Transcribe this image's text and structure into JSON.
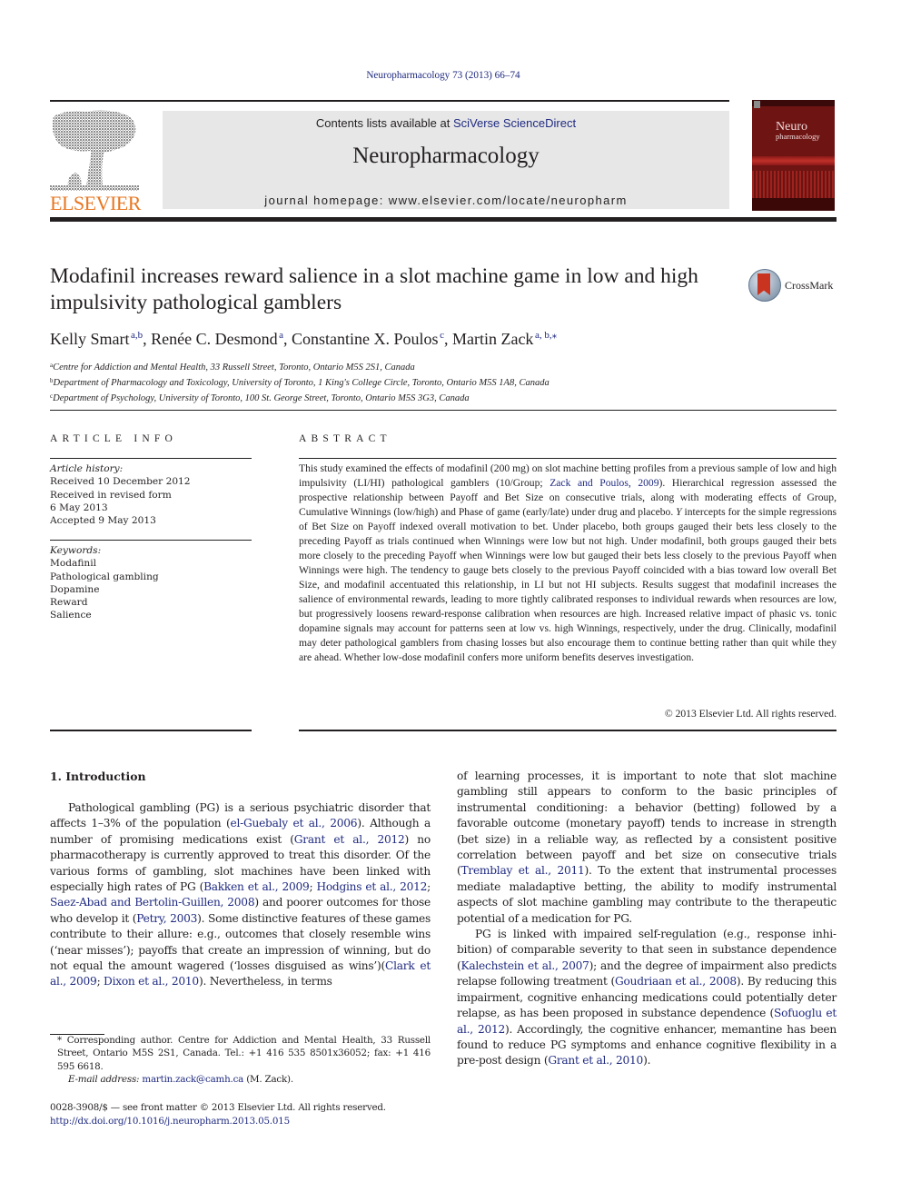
{
  "header": {
    "journal_ref": "Neuropharmacology 73 (2013) 66–74",
    "contents_prefix": "Contents lists available at ",
    "contents_link": "SciVerse ScienceDirect",
    "journal_title": "Neuropharmacology",
    "homepage": "journal homepage: www.elsevier.com/locate/neuropharm",
    "publisher_logo_text": "ELSEVIER",
    "cover": {
      "title_line1": "Neuro",
      "title_line2": "pharmacology"
    },
    "brand_color": "#e87722",
    "link_color": "#1f2a80"
  },
  "article": {
    "title": "Modafinil increases reward salience in a slot machine game in low and high impulsivity pathological gamblers",
    "crossmark_label": "CrossMark",
    "authors": [
      {
        "name": "Kelly Smart",
        "sup": "a,b"
      },
      {
        "name": "Renée C. Desmond",
        "sup": "a"
      },
      {
        "name": "Constantine X. Poulos",
        "sup": "c"
      },
      {
        "name": "Martin Zack",
        "sup": "a, b,⁎"
      }
    ],
    "affiliations": [
      {
        "mark": "a",
        "text": "Centre for Addiction and Mental Health, 33 Russell Street, Toronto, Ontario M5S 2S1, Canada"
      },
      {
        "mark": "b",
        "text": "Department of Pharmacology and Toxicology, University of Toronto, 1 King's College Circle, Toronto, Ontario M5S 1A8, Canada"
      },
      {
        "mark": "c",
        "text": "Department of Psychology, University of Toronto, 100 St. George Street, Toronto, Ontario M5S 3G3, Canada"
      }
    ]
  },
  "article_info": {
    "heading": "ARTICLE INFO",
    "history_label": "Article history:",
    "history": [
      "Received 10 December 2012",
      "Received in revised form",
      "6 May 2013",
      "Accepted 9 May 2013"
    ],
    "keywords_label": "Keywords:",
    "keywords": [
      "Modafinil",
      "Pathological gambling",
      "Dopamine",
      "Reward",
      "Salience"
    ]
  },
  "abstract": {
    "heading": "ABSTRACT",
    "part1": "This study examined the effects of modafinil (200 mg) on slot machine betting profiles from a previous sample of low and high impulsivity (LI/HI) pathological gamblers (10/Group; ",
    "cite1": "Zack and Poulos, 2009",
    "part2": "). Hierarchical regression assessed the prospective relationship between Payoff and Bet Size on consecutive trials, along with moderating effects of Group, Cumulative Winnings (low/high) and Phase of game (early/late) under drug and placebo. ",
    "y_italic": "Y",
    "part3": " intercepts for the simple regressions of Bet Size on Payoff indexed overall motivation to bet. Under placebo, both groups gauged their bets less closely to the preceding Payoff as trials continued when Winnings were low but not high. Under modafinil, both groups gauged their bets more closely to the preceding Payoff when Winnings were low but gauged their bets less closely to the previous Payoff when Winnings were high. The tendency to gauge bets closely to the previous Payoff coincided with a bias toward low overall Bet Size, and modafinil accentuated this rela­tionship, in LI but not HI subjects. Results suggest that modafinil increases the salience of environmental rewards, leading to more tightly calibrated responses to individual rewards when resources are low, but progressively loosens reward-response calibration when resources are high. Increased relative impact of phasic vs. tonic dopamine signals may account for patterns seen at low vs. high Winnings, respectively, under the drug. Clinically, modafinil may deter pathological gamblers from chasing losses but also encourage them to continue betting rather than quit while they are ahead. Whether low-dose modafinil confers more uniform benefits deserves investigation.",
    "copyright": "© 2013 Elsevier Ltd. All rights reserved."
  },
  "introduction": {
    "heading": "1.  Introduction",
    "left": {
      "t1": "Pathological gambling (PG) is a serious psychiatric disorder that affects 1–3% of the population (",
      "c1": "el-Guebaly et al., 2006",
      "t2": "). Although a number of promising medications exist (",
      "c2": "Grant et al., 2012",
      "t3": ") no pharmacotherapy is currently approved to treat this disorder. Of the various forms of gambling, slot machines have been linked with especially high rates of PG (",
      "c3": "Bakken et al., 2009",
      "t4": "; ",
      "c4": "Hodgins et al., 2012",
      "t5": "; ",
      "c5": "Saez-Abad and Bertolin-Guillen, 2008",
      "t6": ") and poorer outcomes for those who develop it (",
      "c6": "Petry, 2003",
      "t7": "). Some distinctive features of these games contribute to their allure: e.g., outcomes that closely resemble wins (‘near misses’); payoffs that create an impression of winning, but do not equal the amount wagered (‘losses disguised as wins’)(",
      "c7": "Clark et al., 2009",
      "t8": "; ",
      "c8": "Dixon et al., 2010",
      "t9": "). Nevertheless, in terms"
    },
    "right_p1": {
      "t1": "of learning processes, it is important to note that slot machine gambling still appears to conform to the basic principles of instrumental conditioning: a behavior (betting) followed by a favorable outcome (monetary payoff) tends to increase in strength (bet size) in a reliable way, as reflected by a consistent positive correlation between payoff and bet size on consecutive trials (",
      "c1": "Tremblay et al., 2011",
      "t2": "). To the extent that instrumental processes mediate maladaptive betting, the ability to modify instrumental aspects of slot machine gambling may contribute to the therapeutic potential of a medication for PG."
    },
    "right_p2": {
      "t1": "PG is linked with impaired self-regulation (e.g., response inhi­bition) of comparable severity to that seen in substance depen­dence (",
      "c1": "Kalechstein et al., 2007",
      "t2": "); and the degree of impairment also predicts relapse following treatment (",
      "c2": "Goudriaan et al., 2008",
      "t3": "). By reducing this impairment, cognitive enhancing medications could potentially deter relapse, as has been proposed in substance dependence (",
      "c3": "Sofuoglu et al., 2012",
      "t4": "). Accordingly, the cognitive enhancer, memantine has been found to reduce PG symptoms and enhance cognitive flexibility in a pre-post design (",
      "c4": "Grant et al., 2010",
      "t5": ")."
    }
  },
  "footnotes": {
    "corresponding": "* Corresponding author. Centre for Addiction and Mental Health, 33 Russell Street, Ontario M5S 2S1, Canada. Tel.: +1 416 535 8501x36052; fax: +1 416 595 6618.",
    "email_label": "E-mail address:",
    "email": "martin.zack@camh.ca",
    "email_suffix": " (M. Zack).",
    "front_matter": "0028-3908/$ — see front matter © 2013 Elsevier Ltd. All rights reserved.",
    "doi": "http://dx.doi.org/10.1016/j.neuropharm.2013.05.015"
  }
}
